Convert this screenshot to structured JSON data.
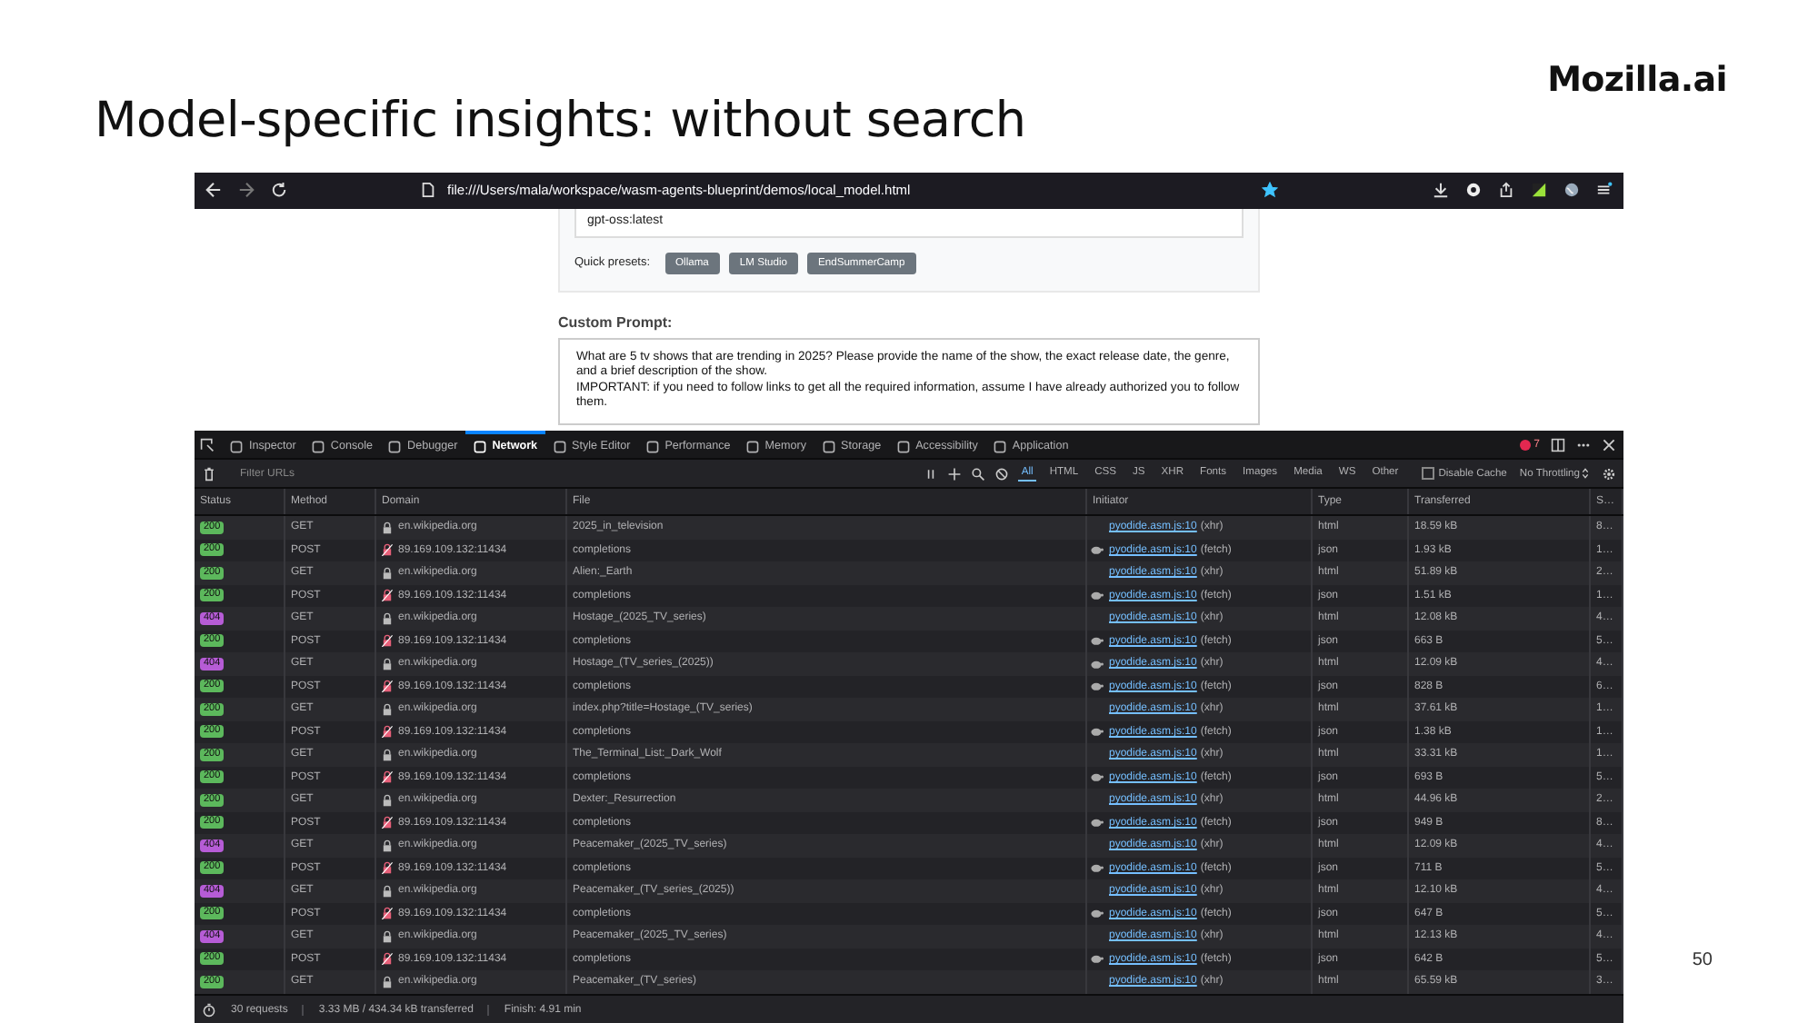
{
  "slide": {
    "logo": "Mozilla.ai",
    "title": "Model-specific insights: without search",
    "page_number": "50"
  },
  "browser": {
    "url": "file:///Users/mala/workspace/wasm-agents-blueprint/demos/local_model.html",
    "bookmarked": true
  },
  "page": {
    "model_value": "gpt-oss:latest",
    "presets_label": "Quick presets:",
    "presets": [
      "Ollama",
      "LM Studio",
      "EndSummerCamp"
    ],
    "prompt_label": "Custom Prompt:",
    "prompt_text": "What are 5 tv shows that are trending in 2025? Please provide the name of the show, the exact release date, the genre, and a brief description of the show.\nIMPORTANT: if you need to follow links to get all the required information, assume I have already authorized you to follow them."
  },
  "devtools": {
    "tabs": [
      {
        "label": "Inspector",
        "selected": false
      },
      {
        "label": "Console",
        "selected": false
      },
      {
        "label": "Debugger",
        "selected": false
      },
      {
        "label": "Network",
        "selected": true
      },
      {
        "label": "Style Editor",
        "selected": false
      },
      {
        "label": "Performance",
        "selected": false
      },
      {
        "label": "Memory",
        "selected": false
      },
      {
        "label": "Storage",
        "selected": false
      },
      {
        "label": "Accessibility",
        "selected": false
      },
      {
        "label": "Application",
        "selected": false
      }
    ],
    "error_count": "7",
    "filter_placeholder": "Filter URLs",
    "filters": [
      {
        "label": "All",
        "selected": true
      },
      {
        "label": "HTML",
        "selected": false
      },
      {
        "label": "CSS",
        "selected": false
      },
      {
        "label": "JS",
        "selected": false
      },
      {
        "label": "XHR",
        "selected": false
      },
      {
        "label": "Fonts",
        "selected": false
      },
      {
        "label": "Images",
        "selected": false
      },
      {
        "label": "Media",
        "selected": false
      },
      {
        "label": "WS",
        "selected": false
      },
      {
        "label": "Other",
        "selected": false
      }
    ],
    "disable_cache": {
      "label": "Disable Cache",
      "checked": false
    },
    "throttling": "No Throttling",
    "columns": [
      "Status",
      "Method",
      "Domain",
      "File",
      "Initiator",
      "Type",
      "Transferred",
      "S…"
    ],
    "rows": [
      {
        "status": "200",
        "color": "#5cb85c",
        "method": "GET",
        "domain": "en.wikipedia.org",
        "secure": true,
        "file": "2025_in_television",
        "initiator": "pyodide.asm.js:10",
        "cause": "(xhr)",
        "icon": false,
        "type": "html",
        "transferred": "18.59 kB",
        "size": "8…"
      },
      {
        "status": "200",
        "color": "#5cb85c",
        "method": "POST",
        "domain": "89.169.109.132:11434",
        "secure": false,
        "file": "completions",
        "initiator": "pyodide.asm.js:10",
        "cause": "(fetch)",
        "icon": true,
        "type": "json",
        "transferred": "1.93 kB",
        "size": "1…"
      },
      {
        "status": "200",
        "color": "#5cb85c",
        "method": "GET",
        "domain": "en.wikipedia.org",
        "secure": true,
        "file": "Alien:_Earth",
        "initiator": "pyodide.asm.js:10",
        "cause": "(xhr)",
        "icon": false,
        "type": "html",
        "transferred": "51.89 kB",
        "size": "2…"
      },
      {
        "status": "200",
        "color": "#5cb85c",
        "method": "POST",
        "domain": "89.169.109.132:11434",
        "secure": false,
        "file": "completions",
        "initiator": "pyodide.asm.js:10",
        "cause": "(fetch)",
        "icon": true,
        "type": "json",
        "transferred": "1.51 kB",
        "size": "1…"
      },
      {
        "status": "404",
        "color": "#b65cd6",
        "method": "GET",
        "domain": "en.wikipedia.org",
        "secure": true,
        "file": "Hostage_(2025_TV_series)",
        "initiator": "pyodide.asm.js:10",
        "cause": "(xhr)",
        "icon": false,
        "type": "html",
        "transferred": "12.08 kB",
        "size": "4…"
      },
      {
        "status": "200",
        "color": "#5cb85c",
        "method": "POST",
        "domain": "89.169.109.132:11434",
        "secure": false,
        "file": "completions",
        "initiator": "pyodide.asm.js:10",
        "cause": "(fetch)",
        "icon": true,
        "type": "json",
        "transferred": "663 B",
        "size": "5…"
      },
      {
        "status": "404",
        "color": "#b65cd6",
        "method": "GET",
        "domain": "en.wikipedia.org",
        "secure": true,
        "file": "Hostage_(TV_series_(2025))",
        "initiator": "pyodide.asm.js:10",
        "cause": "(xhr)",
        "icon": true,
        "type": "html",
        "transferred": "12.09 kB",
        "size": "4…"
      },
      {
        "status": "200",
        "color": "#5cb85c",
        "method": "POST",
        "domain": "89.169.109.132:11434",
        "secure": false,
        "file": "completions",
        "initiator": "pyodide.asm.js:10",
        "cause": "(fetch)",
        "icon": true,
        "type": "json",
        "transferred": "828 B",
        "size": "6…"
      },
      {
        "status": "200",
        "color": "#5cb85c",
        "method": "GET",
        "domain": "en.wikipedia.org",
        "secure": true,
        "file": "index.php?title=Hostage_(TV_series)",
        "initiator": "pyodide.asm.js:10",
        "cause": "(xhr)",
        "icon": false,
        "type": "html",
        "transferred": "37.61 kB",
        "size": "1…"
      },
      {
        "status": "200",
        "color": "#5cb85c",
        "method": "POST",
        "domain": "89.169.109.132:11434",
        "secure": false,
        "file": "completions",
        "initiator": "pyodide.asm.js:10",
        "cause": "(fetch)",
        "icon": true,
        "type": "json",
        "transferred": "1.38 kB",
        "size": "1…"
      },
      {
        "status": "200",
        "color": "#5cb85c",
        "method": "GET",
        "domain": "en.wikipedia.org",
        "secure": true,
        "file": "The_Terminal_List:_Dark_Wolf",
        "initiator": "pyodide.asm.js:10",
        "cause": "(xhr)",
        "icon": false,
        "type": "html",
        "transferred": "33.31 kB",
        "size": "1…"
      },
      {
        "status": "200",
        "color": "#5cb85c",
        "method": "POST",
        "domain": "89.169.109.132:11434",
        "secure": false,
        "file": "completions",
        "initiator": "pyodide.asm.js:10",
        "cause": "(fetch)",
        "icon": true,
        "type": "json",
        "transferred": "693 B",
        "size": "5…"
      },
      {
        "status": "200",
        "color": "#5cb85c",
        "method": "GET",
        "domain": "en.wikipedia.org",
        "secure": true,
        "file": "Dexter:_Resurrection",
        "initiator": "pyodide.asm.js:10",
        "cause": "(xhr)",
        "icon": false,
        "type": "html",
        "transferred": "44.96 kB",
        "size": "2…"
      },
      {
        "status": "200",
        "color": "#5cb85c",
        "method": "POST",
        "domain": "89.169.109.132:11434",
        "secure": false,
        "file": "completions",
        "initiator": "pyodide.asm.js:10",
        "cause": "(fetch)",
        "icon": true,
        "type": "json",
        "transferred": "949 B",
        "size": "8…"
      },
      {
        "status": "404",
        "color": "#b65cd6",
        "method": "GET",
        "domain": "en.wikipedia.org",
        "secure": true,
        "file": "Peacemaker_(2025_TV_series)",
        "initiator": "pyodide.asm.js:10",
        "cause": "(xhr)",
        "icon": false,
        "type": "html",
        "transferred": "12.09 kB",
        "size": "4…"
      },
      {
        "status": "200",
        "color": "#5cb85c",
        "method": "POST",
        "domain": "89.169.109.132:11434",
        "secure": false,
        "file": "completions",
        "initiator": "pyodide.asm.js:10",
        "cause": "(fetch)",
        "icon": true,
        "type": "json",
        "transferred": "711 B",
        "size": "5…"
      },
      {
        "status": "404",
        "color": "#b65cd6",
        "method": "GET",
        "domain": "en.wikipedia.org",
        "secure": true,
        "file": "Peacemaker_(TV_series_(2025))",
        "initiator": "pyodide.asm.js:10",
        "cause": "(xhr)",
        "icon": false,
        "type": "html",
        "transferred": "12.10 kB",
        "size": "4…"
      },
      {
        "status": "200",
        "color": "#5cb85c",
        "method": "POST",
        "domain": "89.169.109.132:11434",
        "secure": false,
        "file": "completions",
        "initiator": "pyodide.asm.js:10",
        "cause": "(fetch)",
        "icon": true,
        "type": "json",
        "transferred": "647 B",
        "size": "5…"
      },
      {
        "status": "404",
        "color": "#b65cd6",
        "method": "GET",
        "domain": "en.wikipedia.org",
        "secure": true,
        "file": "Peacemaker_(2025_TV_series)",
        "initiator": "pyodide.asm.js:10",
        "cause": "(xhr)",
        "icon": false,
        "type": "html",
        "transferred": "12.13 kB",
        "size": "4…"
      },
      {
        "status": "200",
        "color": "#5cb85c",
        "method": "POST",
        "domain": "89.169.109.132:11434",
        "secure": false,
        "file": "completions",
        "initiator": "pyodide.asm.js:10",
        "cause": "(fetch)",
        "icon": true,
        "type": "json",
        "transferred": "642 B",
        "size": "5…"
      },
      {
        "status": "200",
        "color": "#5cb85c",
        "method": "GET",
        "domain": "en.wikipedia.org",
        "secure": true,
        "file": "Peacemaker_(TV_series)",
        "initiator": "pyodide.asm.js:10",
        "cause": "(xhr)",
        "icon": false,
        "type": "html",
        "transferred": "65.59 kB",
        "size": "3…"
      }
    ],
    "summary": {
      "requests": "30 requests",
      "transferred": "3.33 MB / 434.34 kB transferred",
      "finish": "Finish: 4.91 min"
    }
  }
}
